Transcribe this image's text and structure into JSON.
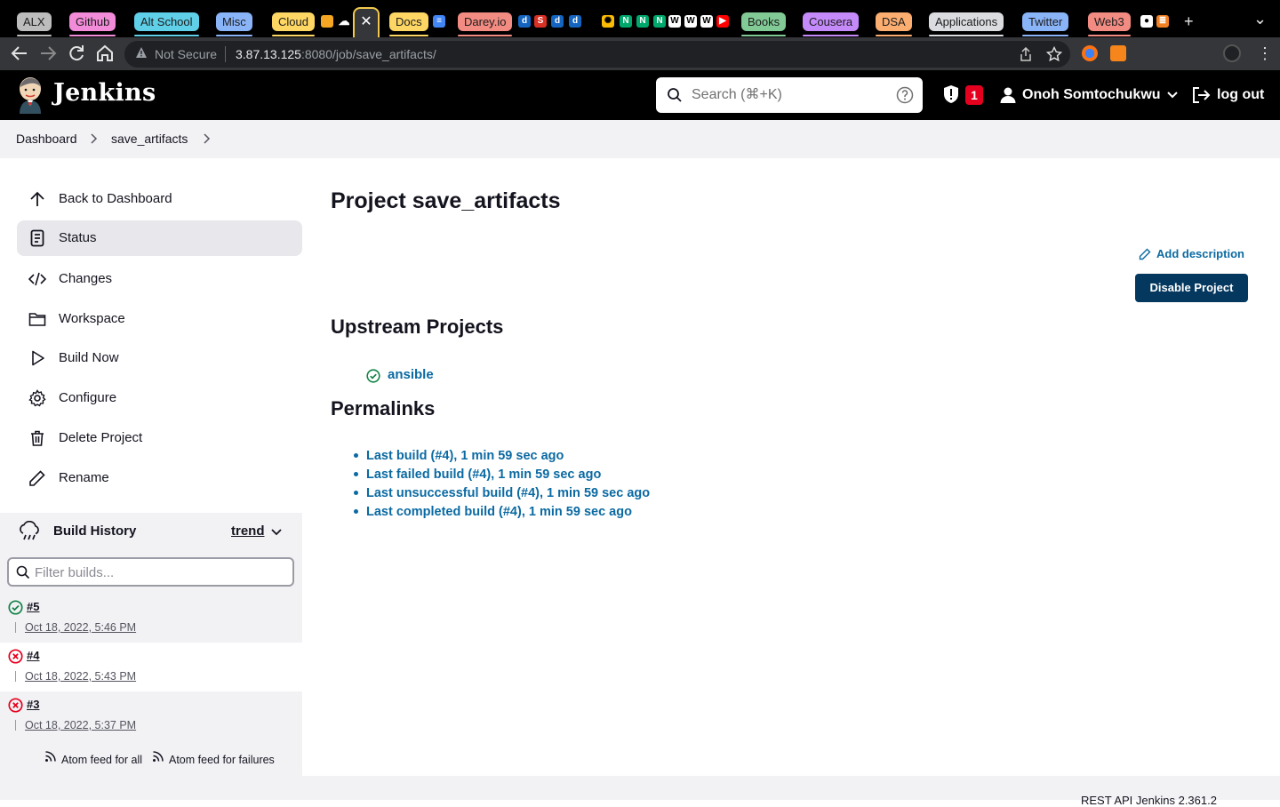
{
  "browser": {
    "tab_groups": [
      {
        "label": "ALX",
        "color": "#bdbdbd"
      },
      {
        "label": "Github",
        "color": "#f28bd8"
      },
      {
        "label": "Alt School",
        "color": "#5fd0e8"
      },
      {
        "label": "Misc",
        "color": "#8ab4f8"
      },
      {
        "label": "Cloud",
        "color": "#fdd663"
      },
      {
        "label": "Docs",
        "color": "#fdd663"
      },
      {
        "label": "Darey.io",
        "color": "#f28b82"
      },
      {
        "label": "Books",
        "color": "#81c995"
      },
      {
        "label": "Cousera",
        "color": "#c58af9"
      },
      {
        "label": "DSA",
        "color": "#fcad70"
      },
      {
        "label": "Applications",
        "color": "#dadce0"
      },
      {
        "label": "Twitter",
        "color": "#8ab4f8"
      },
      {
        "label": "Web3",
        "color": "#f28b82"
      }
    ],
    "active_tab_icon": "✕",
    "new_tab_icon": "+",
    "tab_list_icon": "⌄",
    "security_label": "Not Secure",
    "url_host": "3.87.13.125",
    "url_rest": ":8080/job/save_artifacts/"
  },
  "header": {
    "logo_text": "Jenkins",
    "search_placeholder": "Search (⌘+K)",
    "security_count": "1",
    "user_name": "Onoh Somtochukwu",
    "logout_label": "log out"
  },
  "breadcrumb": {
    "items": [
      "Dashboard",
      "save_artifacts"
    ]
  },
  "sidebar": {
    "tasks": [
      {
        "label": "Back to Dashboard",
        "icon": "arrow-up-icon"
      },
      {
        "label": "Status",
        "icon": "document-icon"
      },
      {
        "label": "Changes",
        "icon": "code-icon"
      },
      {
        "label": "Workspace",
        "icon": "folder-icon"
      },
      {
        "label": "Build Now",
        "icon": "play-icon"
      },
      {
        "label": "Configure",
        "icon": "gear-icon"
      },
      {
        "label": "Delete Project",
        "icon": "trash-icon"
      },
      {
        "label": "Rename",
        "icon": "pencil-icon"
      }
    ]
  },
  "build_history": {
    "title": "Build History",
    "trend_label": "trend",
    "filter_placeholder": "Filter builds...",
    "builds": [
      {
        "number": "#5",
        "date": "Oct 18, 2022, 5:46 PM",
        "status": "success"
      },
      {
        "number": "#4",
        "date": "Oct 18, 2022, 5:43 PM",
        "status": "failed"
      },
      {
        "number": "#3",
        "date": "Oct 18, 2022, 5:37 PM",
        "status": "failed"
      }
    ],
    "atom_all": "Atom feed for all",
    "atom_failures": "Atom feed for failures"
  },
  "main": {
    "title": "Project save_artifacts",
    "add_description": "Add description",
    "disable_button": "Disable Project",
    "upstream_heading": "Upstream Projects",
    "upstream_projects": [
      "ansible"
    ],
    "permalinks_heading": "Permalinks",
    "permalinks": [
      "Last build (#4), 1 min 59 sec ago",
      "Last failed build (#4), 1 min 59 sec ago",
      "Last unsuccessful build (#4), 1 min 59 sec ago",
      "Last completed build (#4), 1 min 59 sec ago"
    ]
  },
  "footer": {
    "text": "REST API    Jenkins 2.361.2"
  },
  "colors": {
    "link": "#0b6aa2",
    "success": "#138347",
    "failure": "#e6001f",
    "button": "#05385e",
    "panel": "#f2f2f5"
  }
}
